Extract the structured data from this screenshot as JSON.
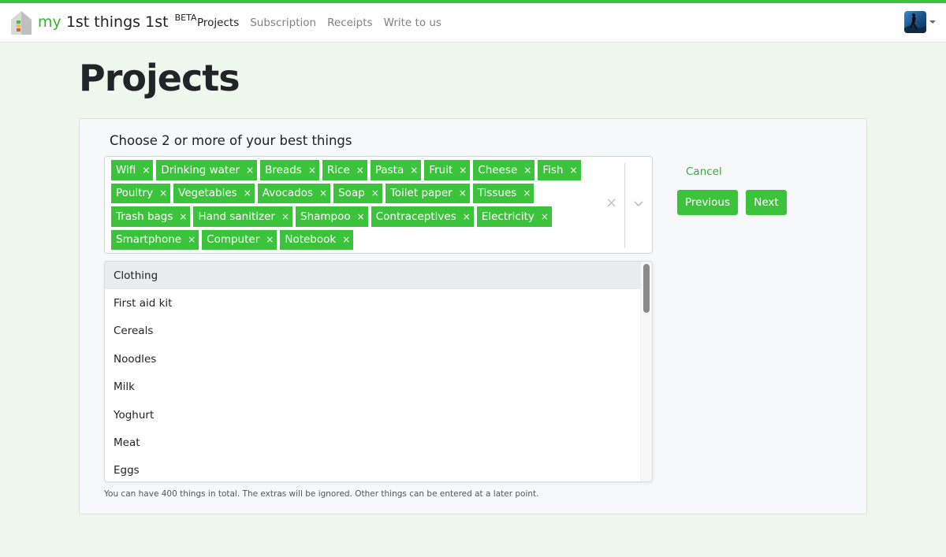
{
  "brand": {
    "my": "my",
    "name": "1st things 1st",
    "badge": "BETA"
  },
  "nav": [
    {
      "label": "Projects",
      "active": true
    },
    {
      "label": "Subscription",
      "active": false
    },
    {
      "label": "Receipts",
      "active": false
    },
    {
      "label": "Write to us",
      "active": false
    }
  ],
  "page": {
    "title": "Projects"
  },
  "form": {
    "label": "Choose 2 or more of your best things",
    "selected_tags": [
      "Wifi",
      "Drinking water",
      "Breads",
      "Rice",
      "Pasta",
      "Fruit",
      "Cheese",
      "Fish",
      "Poultry",
      "Vegetables",
      "Avocados",
      "Soap",
      "Toilet paper",
      "Tissues",
      "Trash bags",
      "Hand sanitizer",
      "Shampoo",
      "Contraceptives",
      "Electricity",
      "Smartphone",
      "Computer",
      "Notebook"
    ],
    "tag_remove_glyph": "×",
    "clear_glyph": "×",
    "options": [
      "Clothing",
      "First aid kit",
      "Cereals",
      "Noodles",
      "Milk",
      "Yoghurt",
      "Meat",
      "Eggs"
    ],
    "highlighted_option": "Clothing",
    "help_text": "You can have 400 things in total. The extras will be ignored. Other things can be entered at a later point."
  },
  "actions": {
    "cancel": "Cancel",
    "previous": "Previous",
    "next": "Next"
  },
  "colors": {
    "accent": "#3cc33c",
    "page_bg": "#eef8ec"
  }
}
